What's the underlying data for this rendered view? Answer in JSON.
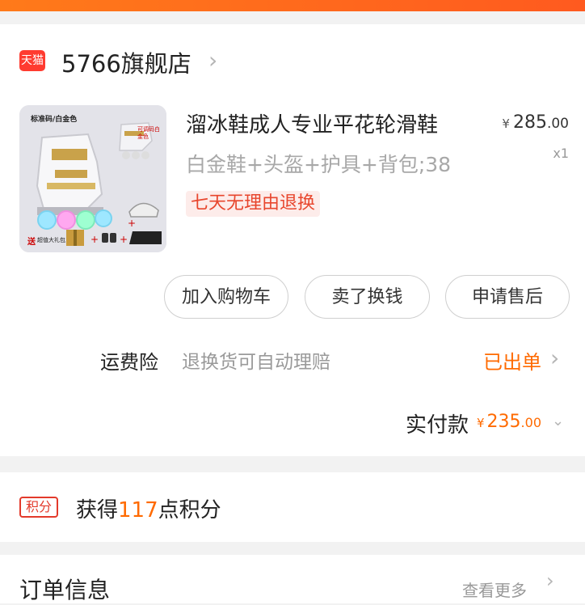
{
  "shop": {
    "badge": "天猫",
    "name": "5766旗舰店"
  },
  "product": {
    "image_text": {
      "top_label": "标准码/白金色",
      "side_note": "可调码白金色",
      "promo": "送",
      "gift": "超值大礼包"
    },
    "title": "溜冰鞋成人专业平花轮滑鞋",
    "price": {
      "currency": "¥",
      "int": "285",
      "dec": ".00"
    },
    "sku": "白金鞋+头盔+护具+背包;38",
    "quantity": "x1",
    "tag": "七天无理由退换"
  },
  "actions": [
    "加入购物车",
    "卖了换钱",
    "申请售后"
  ],
  "insurance": {
    "label": "运费险",
    "desc": "退换货可自动理赔",
    "status": "已出单"
  },
  "payment": {
    "label": "实付款",
    "currency": "¥",
    "int": "235",
    "dec": ".00"
  },
  "points": {
    "badge": "积分",
    "prefix": "获得",
    "value": "117",
    "suffix": "点积分"
  },
  "order": {
    "title": "订单信息",
    "more": "查看更多"
  },
  "colors": {
    "accent": "#ff6a00",
    "brand_red": "#ff3b30"
  }
}
